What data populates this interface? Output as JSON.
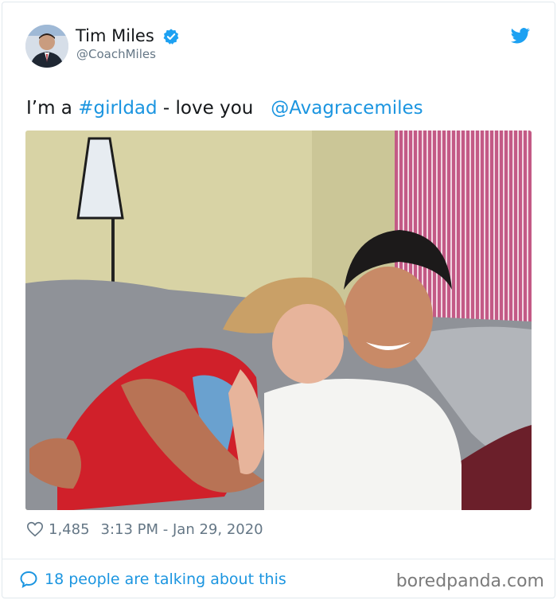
{
  "tweet": {
    "author_name": "Tim Miles",
    "author_handle": "@CoachMiles",
    "text_prefix": "I’m a ",
    "hashtag": "#girldad",
    "text_middle": " - love you   ",
    "mention": "@Avagracemiles",
    "likes": "1,485",
    "timestamp": "3:13 PM - Jan 29, 2020",
    "talking": "18 people are talking about this"
  },
  "icons": {
    "verified": "verified-badge-icon",
    "brand": "twitter-bird-icon",
    "like": "heart-icon",
    "comment": "speech-bubble-icon"
  },
  "colors": {
    "link": "#1b95e0",
    "secondary_text": "#657786",
    "primary_text": "#14171a"
  },
  "watermark": "boredpanda.com"
}
